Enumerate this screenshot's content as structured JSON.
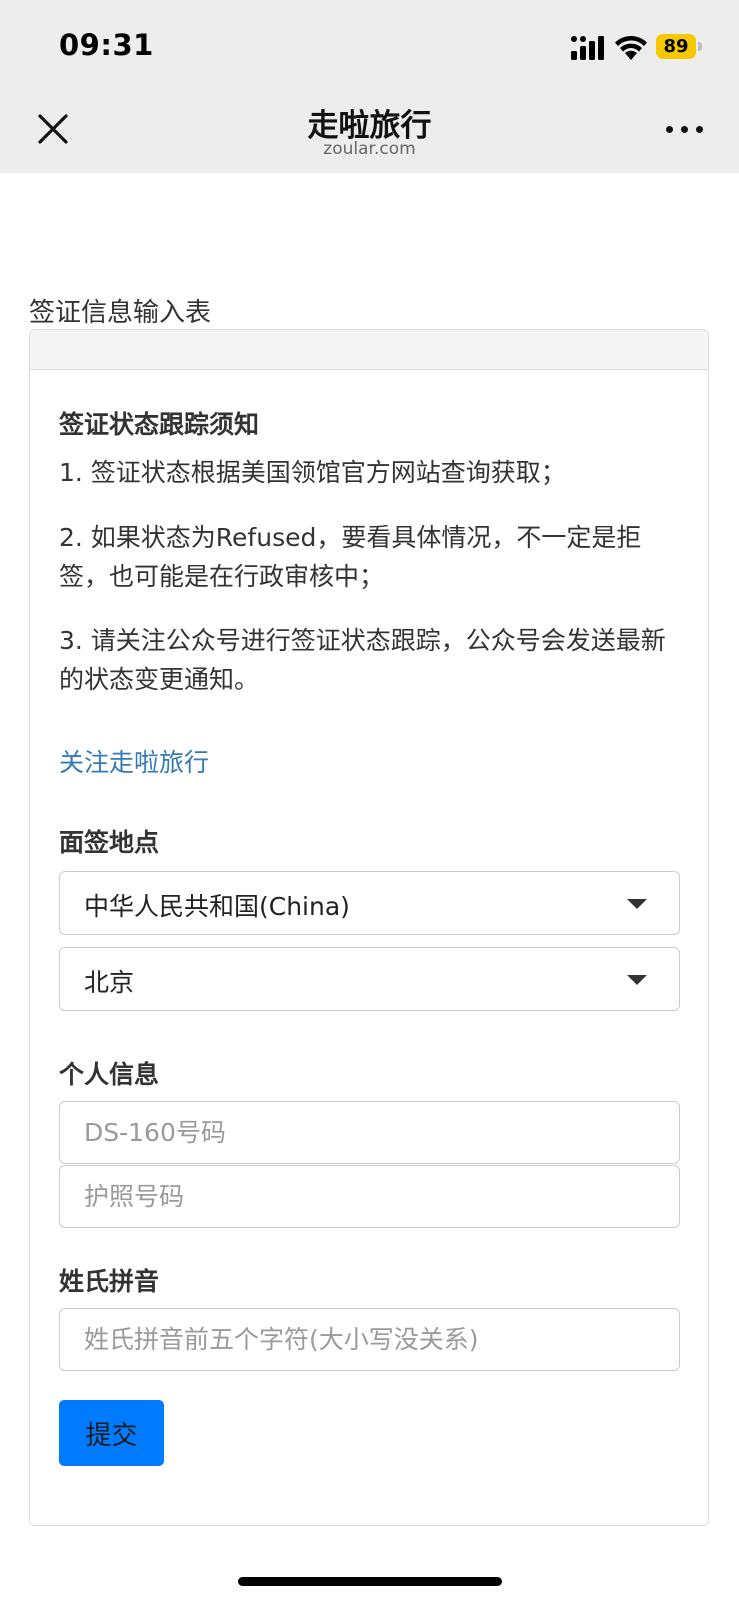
{
  "status_bar": {
    "time": "09:31",
    "battery": "89"
  },
  "nav": {
    "title": "走啦旅行",
    "subtitle": "zoular.com"
  },
  "form": {
    "heading": "签证信息输入表",
    "notice_title": "签证状态跟踪须知",
    "notices": [
      "1. 签证状态根据美国领馆官方网站查询获取；",
      "2. 如果状态为Refused，要看具体情况，不一定是拒签，也可能是在行政审核中；",
      "3. 请关注公众号进行签证状态跟踪，公众号会发送最新的状态变更通知。"
    ],
    "follow_link": "关注走啦旅行",
    "location_label": "面签地点",
    "country_value": "中华人民共和国(China)",
    "city_value": "北京",
    "personal_label": "个人信息",
    "ds160_placeholder": "DS-160号码",
    "passport_placeholder": "护照号码",
    "surname_label": "姓氏拼音",
    "surname_placeholder": "姓氏拼音前五个字符(大小写没关系)",
    "submit_label": "提交"
  },
  "colors": {
    "link": "#337ab7",
    "submit_bg": "#007bff",
    "battery": "#f5c800"
  }
}
